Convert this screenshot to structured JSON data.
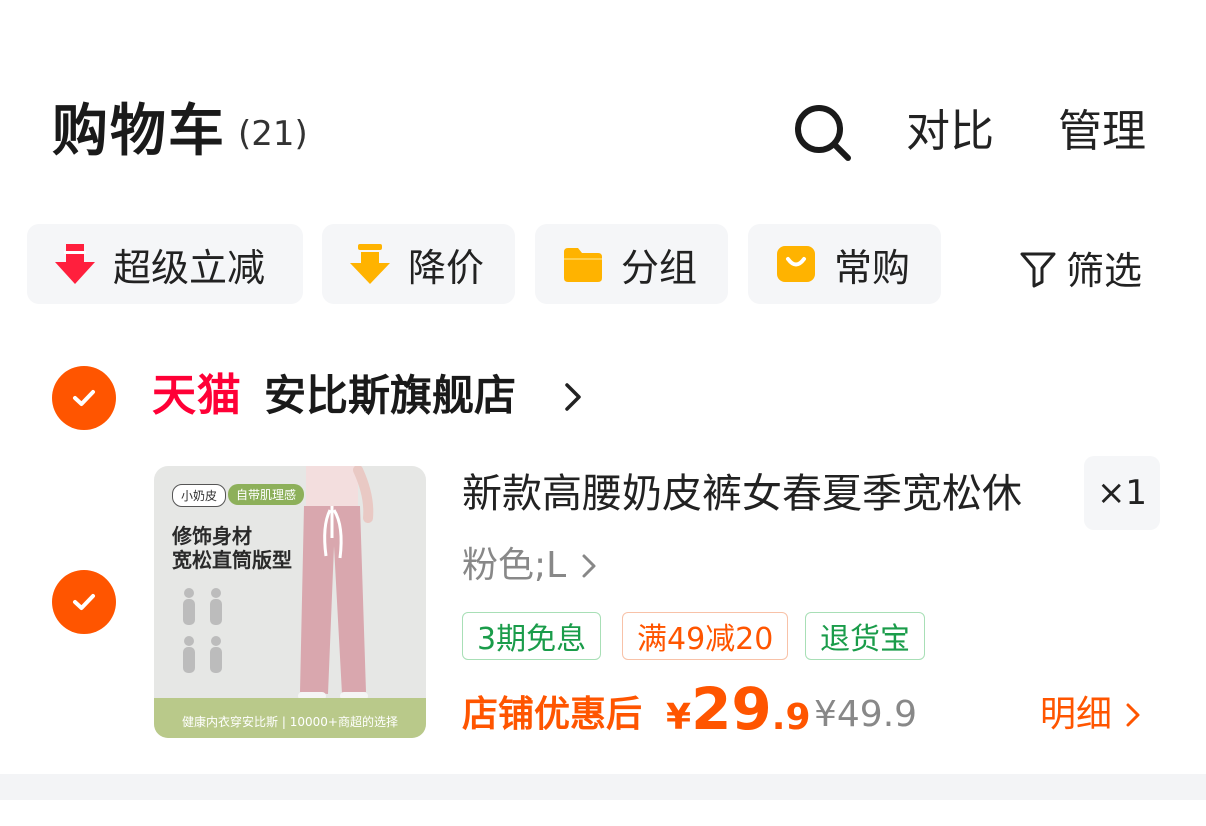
{
  "header": {
    "title": "购物车",
    "count": "(21)",
    "compare_label": "对比",
    "manage_label": "管理"
  },
  "filters": [
    {
      "label": "超级立减",
      "icon": "arrow-down-icon",
      "color": "#ff1f3d"
    },
    {
      "label": "降价",
      "icon": "price-down-icon",
      "color": "#ffb300"
    },
    {
      "label": "分组",
      "icon": "folder-icon",
      "color": "#ffb300"
    },
    {
      "label": "常购",
      "icon": "bag-icon",
      "color": "#ffb300"
    }
  ],
  "filter_button_label": "筛选",
  "store": {
    "platform": "天猫",
    "name": "安比斯旗舰店",
    "checked": true
  },
  "item": {
    "checked": true,
    "title": "新款高腰奶皮裤女春夏季宽松休",
    "quantity": "×1",
    "variant": "粉色;L",
    "image": {
      "tag1": "小奶皮",
      "tag2": "自带肌理感",
      "headline1": "修饰身材",
      "headline2": "宽松直筒版型",
      "caption": "健康内衣穿安比斯 | 10000+商超的选择"
    },
    "promos": [
      "3期免息",
      "满49减20",
      "退货宝"
    ],
    "price_label": "店铺优惠后",
    "price_currency": "¥",
    "price_int": "29",
    "price_dec": ".9",
    "original_price": "¥49.9",
    "detail_label": "明细"
  },
  "colors": {
    "accent": "#ff5500",
    "tmall": "#ff0036",
    "green": "#1a9c4a"
  }
}
